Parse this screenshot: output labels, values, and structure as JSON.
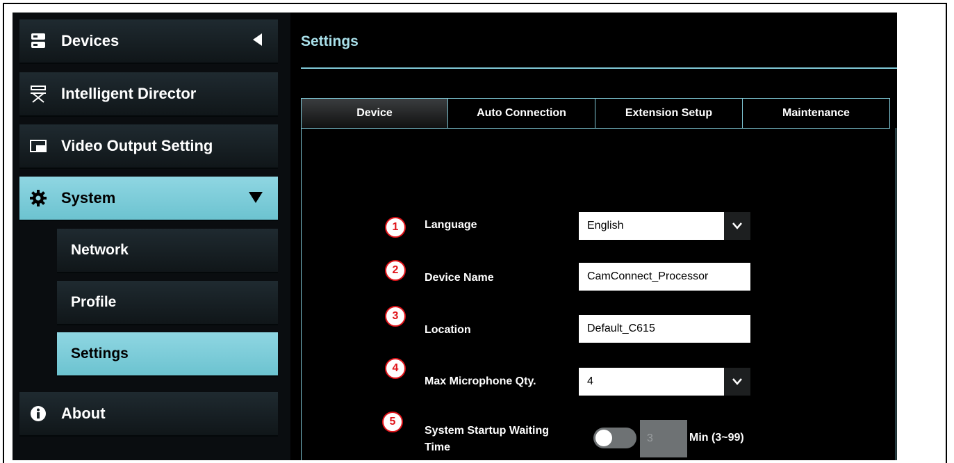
{
  "sidebar": {
    "items": [
      {
        "label": "Devices",
        "icon": "server-icon"
      },
      {
        "label": "Intelligent Director",
        "icon": "director-chair-icon"
      },
      {
        "label": "Video Output Setting",
        "icon": "video-output-icon"
      },
      {
        "label": "System",
        "icon": "gear-icon"
      },
      {
        "label": "Network"
      },
      {
        "label": "Profile"
      },
      {
        "label": "Settings"
      },
      {
        "label": "About",
        "icon": "info-icon"
      }
    ]
  },
  "page": {
    "title": "Settings"
  },
  "tabs": [
    "Device",
    "Auto Connection",
    "Extension Setup",
    "Maintenance"
  ],
  "form": {
    "language": {
      "num": "1",
      "label": "Language",
      "value": "English"
    },
    "device_name": {
      "num": "2",
      "label": "Device Name",
      "value": "CamConnect_Processor"
    },
    "location": {
      "num": "3",
      "label": "Location",
      "value": "Default_C615"
    },
    "max_mic": {
      "num": "4",
      "label": "Max Microphone Qty.",
      "value": "4"
    },
    "startup_wait": {
      "num": "5",
      "label_line1": "System Startup Waiting",
      "label_line2": "Time",
      "value": "3",
      "unit": "Min (3~99)",
      "enabled": false
    }
  },
  "colors": {
    "accent": "#7fc8d6",
    "active_bg": "#8fd6e2",
    "annotation": "#e0141a"
  }
}
